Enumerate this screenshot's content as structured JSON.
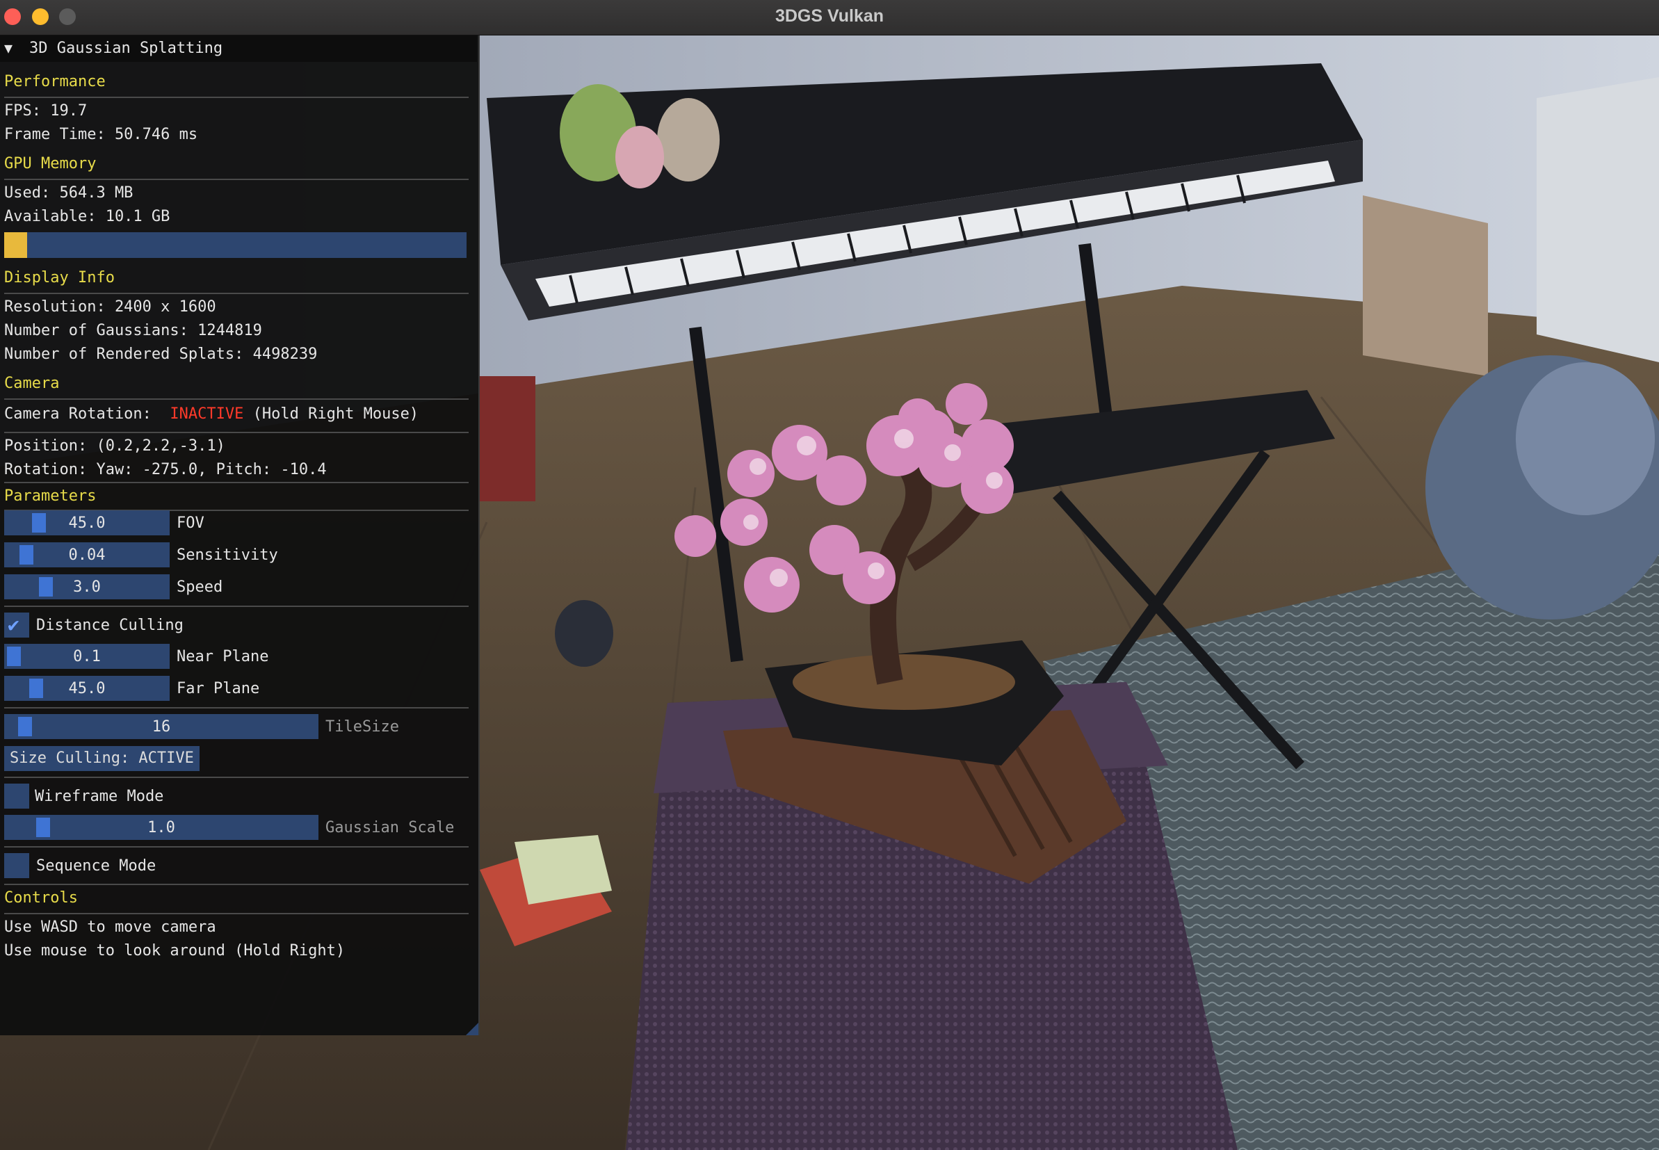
{
  "window": {
    "title": "3DGS Vulkan"
  },
  "panel": {
    "title": "3D Gaussian Splatting",
    "performance": {
      "heading": "Performance",
      "fps": "FPS: 19.7",
      "frame_time": "Frame Time: 50.746 ms"
    },
    "gpu_memory": {
      "heading": "GPU Memory",
      "used": "Used: 564.3 MB",
      "available": "Available: 10.1 GB",
      "usage_fraction": 0.05,
      "bar_color": "#e8b93c"
    },
    "display_info": {
      "heading": "Display Info",
      "resolution": "Resolution: 2400 x 1600",
      "gaussians": "Number of Gaussians: 1244819",
      "rendered_splats": "Number of Rendered Splats: 4498239"
    },
    "camera": {
      "heading": "Camera",
      "rotation_label": "Camera Rotation: ",
      "rotation_state": "INACTIVE",
      "rotation_hint": "(Hold Right Mouse)",
      "position": "Position: (0.2,2.2,-3.1)",
      "rotation": "Rotation: Yaw: -275.0, Pitch: -10.4"
    },
    "parameters": {
      "heading": "Parameters",
      "fov": {
        "value": "45.0",
        "label": "FOV"
      },
      "sensitivity": {
        "value": "0.04",
        "label": "Sensitivity"
      },
      "speed": {
        "value": "3.0",
        "label": "Speed"
      },
      "distance_culling": {
        "label": "Distance Culling",
        "checked": true
      },
      "near_plane": {
        "value": "0.1",
        "label": "Near Plane"
      },
      "far_plane": {
        "value": "45.0",
        "label": "Far Plane"
      },
      "tile_size": {
        "value": "16",
        "label": "TileSize"
      },
      "size_culling_button": "Size Culling: ACTIVE",
      "wireframe_mode": {
        "label": "Wireframe Mode",
        "checked": false
      },
      "gaussian_scale": {
        "value": "1.0",
        "label": "Gaussian Scale"
      },
      "sequence_mode": {
        "label": "Sequence Mode",
        "checked": false
      }
    },
    "controls": {
      "heading": "Controls",
      "line1": "Use WASD to move camera",
      "line2": "Use mouse to look around (Hold Right)"
    }
  },
  "colors": {
    "section_heading": "#e8dc4a",
    "inactive": "#ff3a2a",
    "widget_bg": "#2d4670",
    "widget_grab": "#3f74d4"
  }
}
